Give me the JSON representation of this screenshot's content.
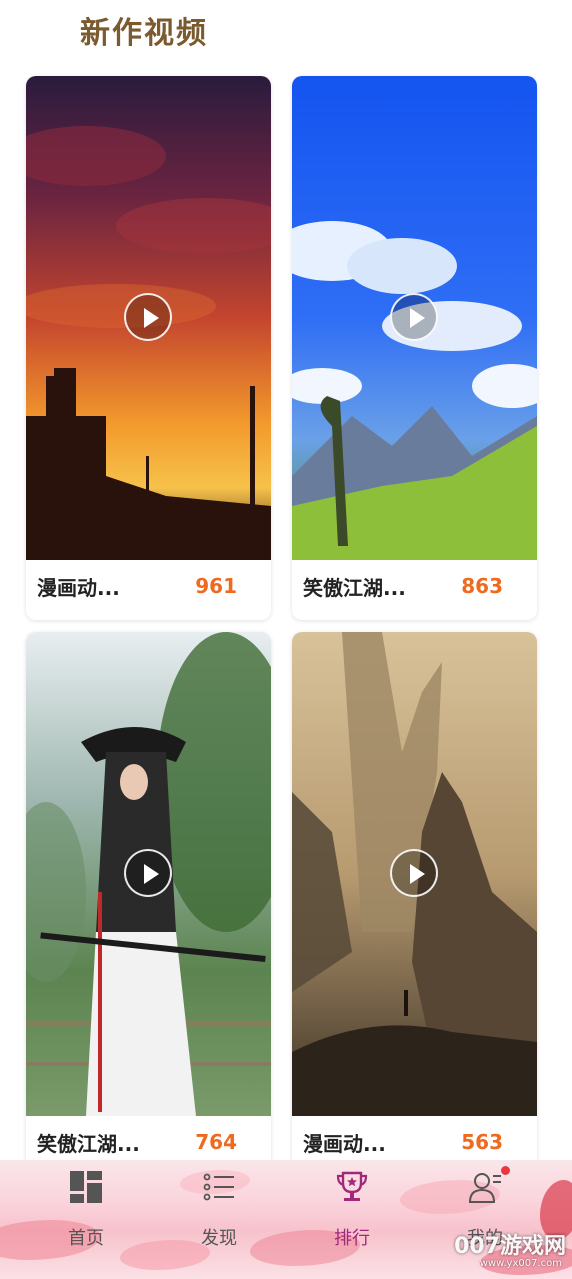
{
  "section_title": "新作视频",
  "videos": [
    {
      "title": "漫画动...",
      "count": "961",
      "thumbnail": "sunset-industrial-skyline"
    },
    {
      "title": "笑傲江湖...",
      "count": "863",
      "thumbnail": "blue-sky-robot-landscape"
    },
    {
      "title": "笑傲江湖...",
      "count": "764",
      "thumbnail": "swordswoman-in-hanfu"
    },
    {
      "title": "漫画动...",
      "count": "563",
      "thumbnail": "misty-rock-spires"
    }
  ],
  "tabs": [
    {
      "label": "首页",
      "icon": "grid-icon",
      "active": false
    },
    {
      "label": "发现",
      "icon": "list-icon",
      "active": false
    },
    {
      "label": "排行",
      "icon": "trophy-icon",
      "active": true
    },
    {
      "label": "我的",
      "icon": "user-icon",
      "active": false,
      "badge": true
    }
  ],
  "colors": {
    "title": "#7a5a2e",
    "count": "#ef6a1e",
    "active_tab": "#a0297a",
    "badge": "#e8383d"
  },
  "watermark": {
    "text": "007游戏网",
    "sub": "www.yx007.com"
  }
}
